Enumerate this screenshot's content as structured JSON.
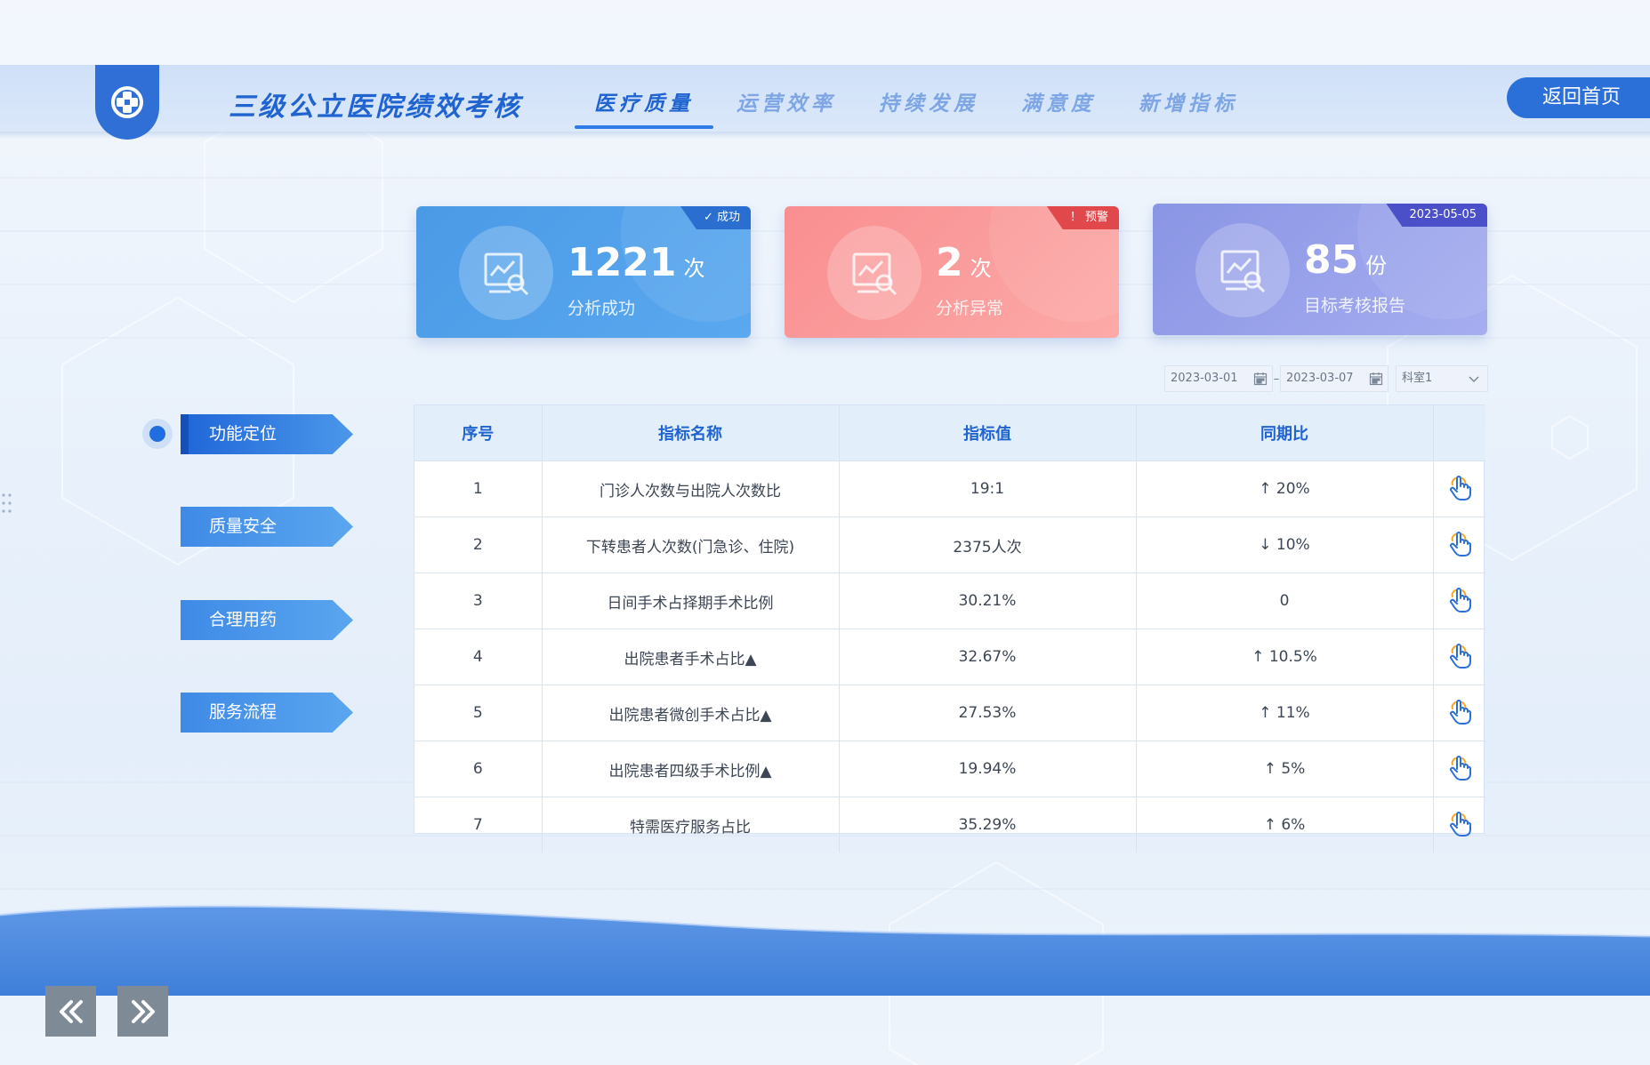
{
  "header": {
    "title": "三级公立医院绩效考核",
    "tabs": [
      {
        "label": "医疗质量"
      },
      {
        "label": "运营效率"
      },
      {
        "label": "持续发展"
      },
      {
        "label": "满意度"
      },
      {
        "label": "新增指标"
      }
    ],
    "active_tab": "医疗质量",
    "home_button": "返回首页"
  },
  "cards": [
    {
      "tag": "✓ 成功",
      "value": "1221",
      "unit": "次",
      "label": "分析成功"
    },
    {
      "tag": "！ 预警",
      "value": "2",
      "unit": "次",
      "label": "分析异常"
    },
    {
      "tag": "2023-05-05",
      "value": "85",
      "unit": "份",
      "label": "目标考核报告"
    }
  ],
  "filters": {
    "start_date": "2023-03-01",
    "separator": "–",
    "end_date": "2023-03-07",
    "department": "科室1"
  },
  "table": {
    "headers": [
      "序号",
      "指标名称",
      "指标值",
      "同期比",
      ""
    ],
    "rows": [
      {
        "no": "1",
        "name": "门诊人次数与出院人次数比",
        "value": "19:1",
        "yoy": "↑ 20%"
      },
      {
        "no": "2",
        "name": "下转患者人次数(门急诊、住院)",
        "value": "2375人次",
        "yoy": "↓ 10%"
      },
      {
        "no": "3",
        "name": "日间手术占择期手术比例",
        "value": "30.21%",
        "yoy": "0"
      },
      {
        "no": "4",
        "name": "出院患者手术占比▲",
        "value": "32.67%",
        "yoy": "↑ 10.5%"
      },
      {
        "no": "5",
        "name": "出院患者微创手术占比▲",
        "value": "27.53%",
        "yoy": "↑ 11%"
      },
      {
        "no": "6",
        "name": "出院患者四级手术比例▲",
        "value": "19.94%",
        "yoy": "↑ 5%"
      },
      {
        "no": "7",
        "name": "特需医疗服务占比",
        "value": "35.29%",
        "yoy": "↑ 6%"
      }
    ]
  },
  "sidebar": {
    "items": [
      {
        "label": "功能定位"
      },
      {
        "label": "质量安全"
      },
      {
        "label": "合理用药"
      },
      {
        "label": "服务流程"
      }
    ]
  },
  "icons": {
    "logo": "medical-cross-icon",
    "card": "chart-search-icon",
    "row_action": "hand-pointer-icon",
    "calendar": "calendar-icon",
    "select": "chevron-down-icon",
    "prev": "double-chevron-left-icon",
    "next": "double-chevron-right-icon"
  },
  "colors": {
    "primary": "#2b6fd9",
    "success_card": "#4a9ae6",
    "warning_card": "#f98e90",
    "report_card": "#8a95e4"
  }
}
